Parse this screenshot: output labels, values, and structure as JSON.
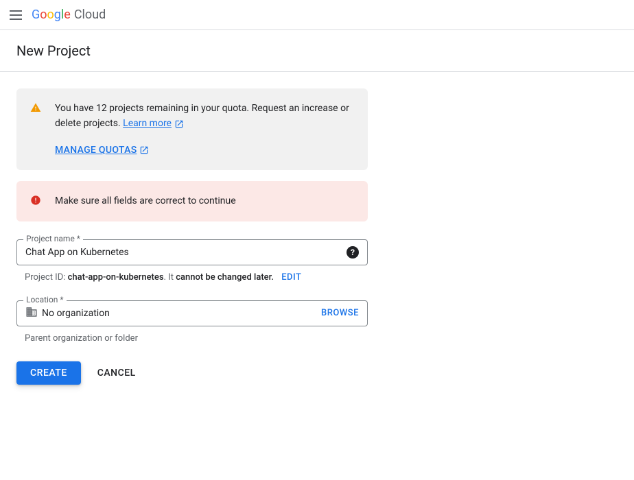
{
  "header": {
    "logo_google": "Google",
    "logo_cloud": "Cloud"
  },
  "page": {
    "title": "New Project"
  },
  "quota_alert": {
    "message_part1": "You have 12 projects remaining in your quota. Request an increase or delete projects. ",
    "learn_more_label": "Learn more",
    "manage_quotas_label": "MANAGE QUOTAS"
  },
  "error_alert": {
    "message": "Make sure all fields are correct to continue"
  },
  "form": {
    "project_name": {
      "label": "Project name *",
      "value": "Chat App on Kubernetes",
      "helper_prefix": "Project ID: ",
      "project_id": "chat-app-on-kubernetes",
      "helper_mid": ". It ",
      "helper_cannot_change": "cannot be changed later.",
      "edit_label": "EDIT"
    },
    "location": {
      "label": "Location *",
      "value": "No organization",
      "browse_label": "BROWSE",
      "helper": "Parent organization or folder"
    }
  },
  "buttons": {
    "create": "CREATE",
    "cancel": "CANCEL"
  }
}
